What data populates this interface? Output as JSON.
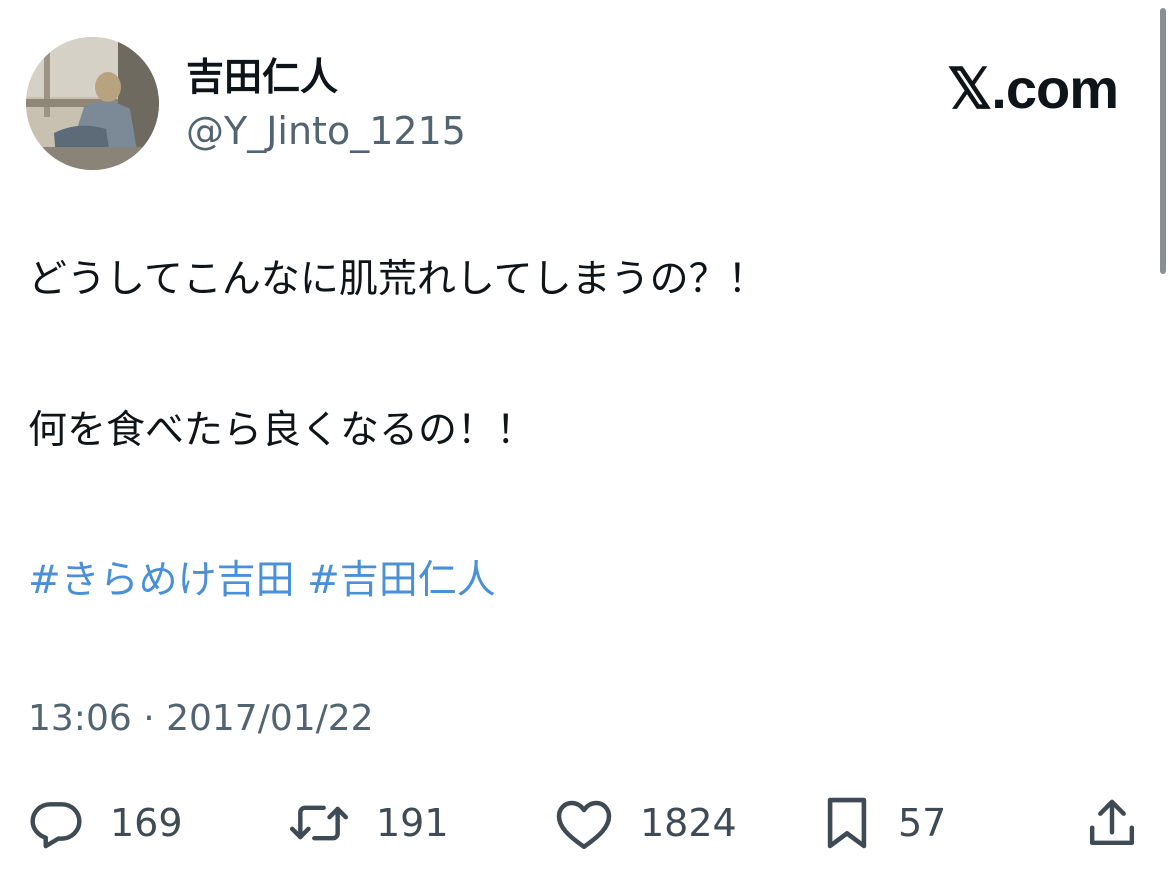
{
  "author": {
    "display_name": "吉田仁人",
    "handle": "@Y_Jinto_1215"
  },
  "brand": "𝕏.com",
  "tweet": {
    "line1": "どうしてこんなに肌荒れしてしまうの？！",
    "line2": "何を食べたら良くなるの！！",
    "hashtags": [
      "#きらめけ吉田",
      "#吉田仁人"
    ]
  },
  "timestamp": "13:06 · 2017/01/22",
  "actions": {
    "reply_count": "169",
    "retweet_count": "191",
    "like_count": "1824",
    "bookmark_count": "57"
  },
  "colors": {
    "text": "#0f1419",
    "secondary": "#536471",
    "hashtag": "#4a90d9",
    "icon": "#3e4a54"
  },
  "icons": {
    "reply": "reply-icon",
    "retweet": "retweet-icon",
    "like": "heart-icon",
    "bookmark": "bookmark-icon",
    "share": "share-icon"
  }
}
